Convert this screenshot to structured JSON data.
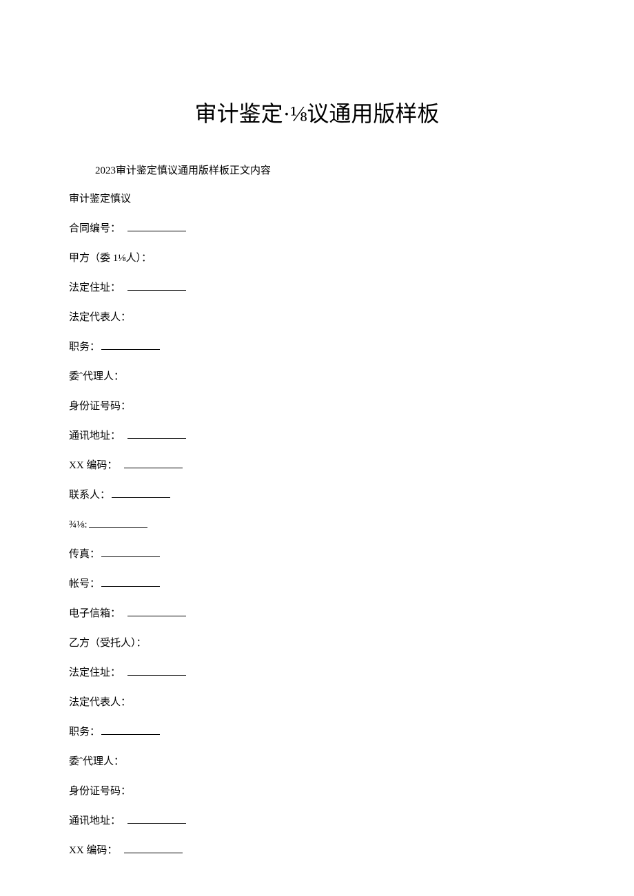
{
  "title": "审计鉴定·⅛议通用版样板",
  "intro": "2023审计鉴定慎议通用版样板正文内容",
  "lines": [
    {
      "label": "审计鉴定慎议",
      "blank": false
    },
    {
      "label": "合同编号：",
      "blank": true,
      "spaced": true
    },
    {
      "label": "甲方（委 1⅛人）：",
      "blank": false
    },
    {
      "label": "法定住址：",
      "blank": true,
      "spaced": true
    },
    {
      "label": "法定代表人：",
      "blank": false
    },
    {
      "label": "职务：",
      "blank": true
    },
    {
      "label": "委ˆ代理人：",
      "blank": false
    },
    {
      "label": "身份证号码：",
      "blank": false
    },
    {
      "label": "通讯地址：",
      "blank": true,
      "spaced": true
    },
    {
      "label": "XX 编码：",
      "blank": true,
      "spaced": true
    },
    {
      "label": "联系人：",
      "blank": true
    },
    {
      "label": "¾⅛:",
      "blank": true
    },
    {
      "label": "传真：",
      "blank": true
    },
    {
      "label": "帐号：",
      "blank": true
    },
    {
      "label": "电子信箱：",
      "blank": true,
      "spaced": true
    },
    {
      "label": "乙方（受托人）：",
      "blank": false
    },
    {
      "label": "法定住址：",
      "blank": true,
      "spaced": true
    },
    {
      "label": "法定代表人：",
      "blank": false
    },
    {
      "label": "职务：",
      "blank": true
    },
    {
      "label": "委ˆ代理人：",
      "blank": false
    },
    {
      "label": "身份证号码：",
      "blank": false
    },
    {
      "label": "通讯地址：",
      "blank": true,
      "spaced": true
    },
    {
      "label": "XX 编码：",
      "blank": true,
      "spaced": true
    }
  ]
}
